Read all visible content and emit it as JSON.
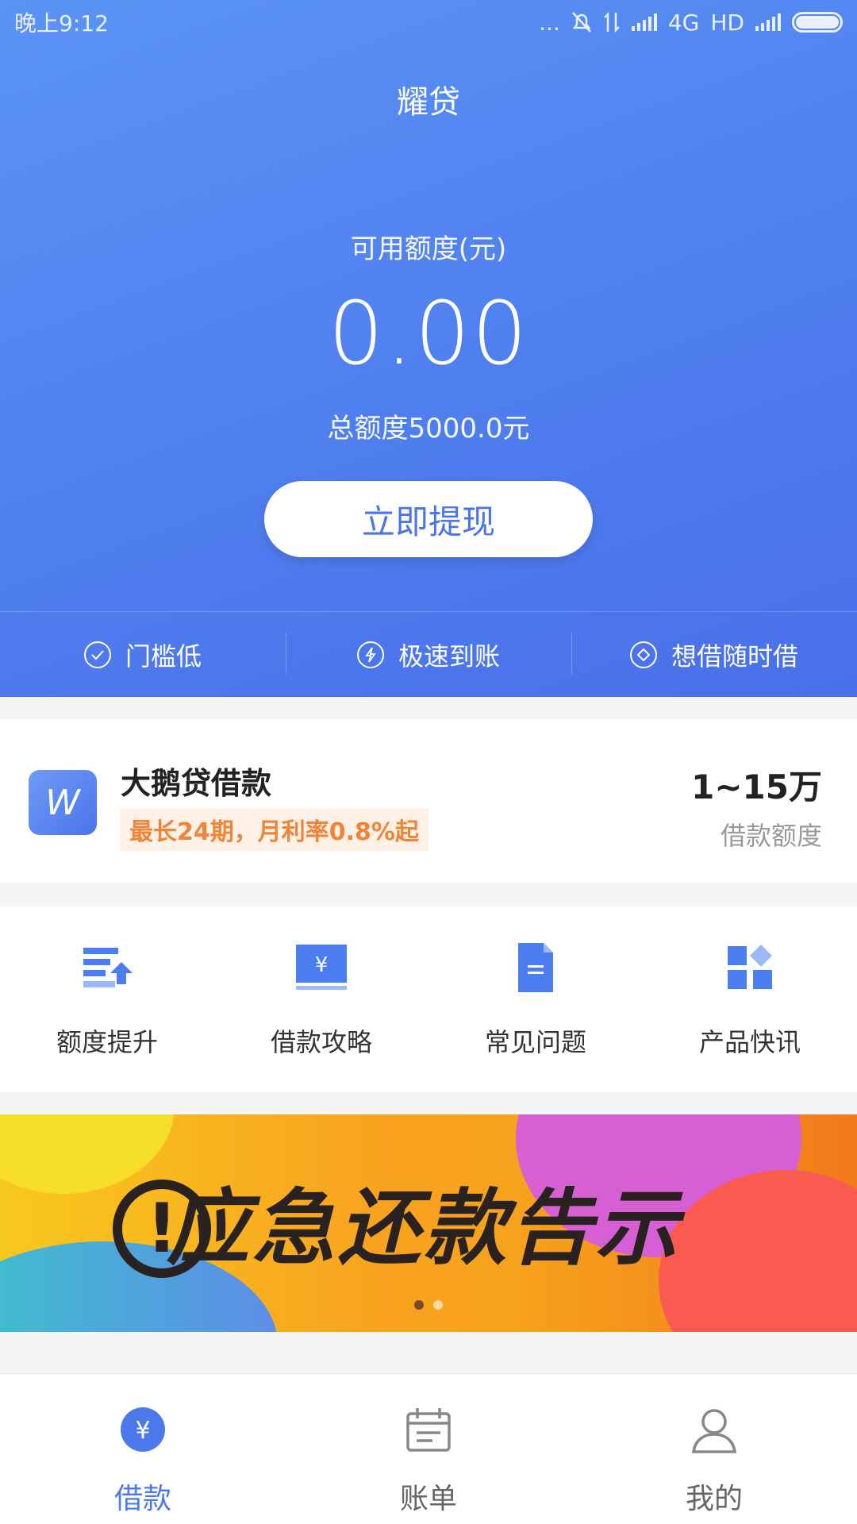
{
  "status_bar": {
    "time": "晚上9:12",
    "network": "4G",
    "hd": "HD",
    "dots": "..."
  },
  "header": {
    "title": "耀贷"
  },
  "credit": {
    "available_label": "可用额度(元)",
    "available_amount": "0.00",
    "total_label": "总额度5000.0元"
  },
  "cta": {
    "label": "立即提现"
  },
  "features": [
    {
      "label": "门槛低",
      "icon": "check-circle-icon"
    },
    {
      "label": "极速到账",
      "icon": "lightning-icon"
    },
    {
      "label": "想借随时借",
      "icon": "diamond-icon"
    }
  ],
  "product": {
    "logo_text": "W",
    "name": "大鹅贷借款",
    "tag": "最长24期，月利率0.8%起",
    "range": "1~15万",
    "range_label": "借款额度"
  },
  "quick_links": [
    {
      "label": "额度提升",
      "icon": "limit-increase-icon"
    },
    {
      "label": "借款攻略",
      "icon": "loan-guide-icon"
    },
    {
      "label": "常见问题",
      "icon": "faq-document-icon"
    },
    {
      "label": "产品快讯",
      "icon": "product-news-icon"
    }
  ],
  "banner": {
    "text": "应急还款告示",
    "alert_mark": "!",
    "slide_count": 2,
    "active_slide": 1
  },
  "tabbar": [
    {
      "label": "借款",
      "icon": "yuan-circle-icon",
      "active": true
    },
    {
      "label": "账单",
      "icon": "calendar-bill-icon",
      "active": false
    },
    {
      "label": "我的",
      "icon": "user-icon",
      "active": false
    }
  ],
  "colors": {
    "primary": "#4f7fef",
    "accent_orange": "#f08439",
    "tag_bg": "#fff1e6",
    "active_tab": "#4b79ec"
  }
}
